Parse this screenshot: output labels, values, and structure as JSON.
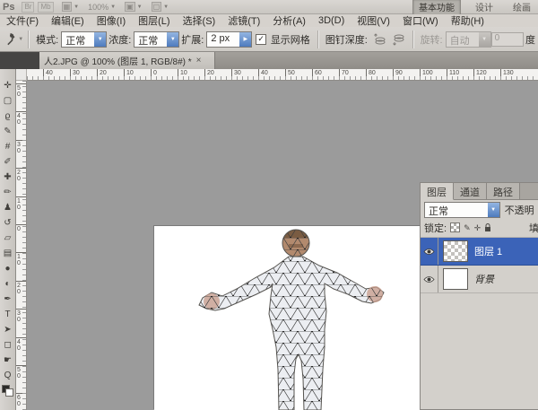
{
  "app_bar": {
    "logo": "Ps",
    "bridge_label": "Br",
    "mini_bridge_label": "Mb",
    "zoom_level": "100%",
    "workspace_buttons": [
      {
        "label": "基本功能",
        "active": true
      },
      {
        "label": "设计",
        "active": false
      },
      {
        "label": "绘画",
        "active": false
      }
    ]
  },
  "menu_bar": {
    "items": [
      "文件(F)",
      "编辑(E)",
      "图像(I)",
      "图层(L)",
      "选择(S)",
      "滤镜(T)",
      "分析(A)",
      "3D(D)",
      "视图(V)",
      "窗口(W)",
      "帮助(H)"
    ]
  },
  "options_bar": {
    "tool_icon": "puppet-warp-pin",
    "mode_label": "模式:",
    "mode_value": "正常",
    "density_label": "浓度:",
    "density_value": "正常",
    "expansion_label": "扩展:",
    "expansion_value": "2 px",
    "show_mesh_label": "显示网格",
    "show_mesh_checked": true,
    "pin_depth_label": "图钉深度:",
    "rotate_label": "旋转:",
    "rotate_value": "自动",
    "rotate_angle": "0",
    "degree_label": "度"
  },
  "document_tab": {
    "title": "人2.JPG @ 100% (图层 1, RGB/8#) *"
  },
  "toolbar": {
    "tools": [
      {
        "name": "move-tool",
        "glyph": "✛"
      },
      {
        "name": "marquee-tool",
        "glyph": "▢"
      },
      {
        "name": "lasso-tool",
        "glyph": "ϱ"
      },
      {
        "name": "quick-selection-tool",
        "glyph": "✎"
      },
      {
        "name": "crop-tool",
        "glyph": "#"
      },
      {
        "name": "eyedropper-tool",
        "glyph": "✐"
      },
      {
        "name": "healing-brush-tool",
        "glyph": "✚"
      },
      {
        "name": "brush-tool",
        "glyph": "✏"
      },
      {
        "name": "clone-stamp-tool",
        "glyph": "♟"
      },
      {
        "name": "history-brush-tool",
        "glyph": "↺"
      },
      {
        "name": "eraser-tool",
        "glyph": "▱"
      },
      {
        "name": "gradient-tool",
        "glyph": "▤"
      },
      {
        "name": "blur-tool",
        "glyph": "●"
      },
      {
        "name": "dodge-tool",
        "glyph": "◐"
      },
      {
        "name": "pen-tool",
        "glyph": "✒"
      },
      {
        "name": "type-tool",
        "glyph": "T"
      },
      {
        "name": "path-selection-tool",
        "glyph": "➤"
      },
      {
        "name": "shape-tool",
        "glyph": "◻"
      },
      {
        "name": "hand-tool",
        "glyph": "☛"
      },
      {
        "name": "zoom-tool",
        "glyph": "Q"
      }
    ]
  },
  "rulers": {
    "horizontal": [
      "40",
      "30",
      "20",
      "10",
      "0",
      "10",
      "20",
      "30",
      "40",
      "50",
      "60",
      "70",
      "80",
      "90",
      "100",
      "110",
      "120",
      "130"
    ],
    "vertical": [
      "50",
      "40",
      "30",
      "20",
      "10",
      "0",
      "10",
      "20",
      "30",
      "40",
      "50",
      "60"
    ]
  },
  "layers_panel": {
    "tabs": [
      "图层",
      "通道",
      "路径"
    ],
    "blend_mode": "正常",
    "opacity_label": "不透明",
    "lock_label": "锁定:",
    "fill_label": "填",
    "layers": [
      {
        "name": "图层 1",
        "selected": true
      },
      {
        "name": "背景",
        "selected": false
      }
    ]
  },
  "icons": {
    "dropdown": "▼",
    "spinner_right": "▶",
    "close": "×",
    "check": "✓",
    "grid": "▦",
    "arrange": "▣",
    "screen": "▢",
    "lock_brush": "✎",
    "lock_move": "✛"
  },
  "colors": {
    "selection_blue": "#3b63b8",
    "workspace_gray": "#9b9b9b",
    "panel_gray": "#d3d0cb",
    "canvas_white": "#ffffff",
    "mesh_line": "#3d3d3d"
  }
}
